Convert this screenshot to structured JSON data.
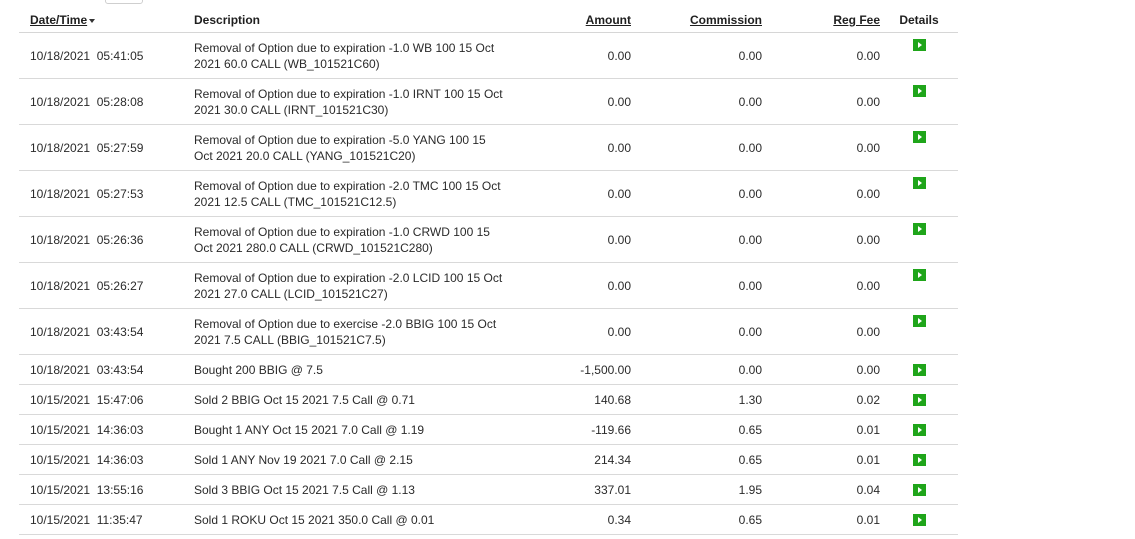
{
  "headers": {
    "datetime": "Date/Time",
    "description": "Description",
    "amount": "Amount",
    "commission": "Commission",
    "reg_fee": "Reg Fee",
    "details": "Details"
  },
  "colors": {
    "negative": "#d0021b",
    "positive": "#1b9a2a",
    "details_button": "#1fa51a"
  },
  "icons": {
    "details": "play-icon",
    "sort": "sort-desc-icon"
  },
  "rows": [
    {
      "datetime": "10/18/2021  05:41:05",
      "desc1": "Removal of Option due to expiration -1.0 WB 100 15 Oct",
      "desc2": "2021 60.0 CALL (WB_101521C60)",
      "amount": "0.00",
      "commission": "0.00",
      "reg_fee": "0.00",
      "sign": ""
    },
    {
      "datetime": "10/18/2021  05:28:08",
      "desc1": "Removal of Option due to expiration -1.0 IRNT 100 15 Oct",
      "desc2": "2021 30.0 CALL (IRNT_101521C30)",
      "amount": "0.00",
      "commission": "0.00",
      "reg_fee": "0.00",
      "sign": ""
    },
    {
      "datetime": "10/18/2021  05:27:59",
      "desc1": "Removal of Option due to expiration -5.0 YANG 100 15",
      "desc2": "Oct 2021 20.0 CALL (YANG_101521C20)",
      "amount": "0.00",
      "commission": "0.00",
      "reg_fee": "0.00",
      "sign": ""
    },
    {
      "datetime": "10/18/2021  05:27:53",
      "desc1": "Removal of Option due to expiration -2.0 TMC 100 15 Oct",
      "desc2": "2021 12.5 CALL (TMC_101521C12.5)",
      "amount": "0.00",
      "commission": "0.00",
      "reg_fee": "0.00",
      "sign": ""
    },
    {
      "datetime": "10/18/2021  05:26:36",
      "desc1": "Removal of Option due to expiration -1.0 CRWD 100 15",
      "desc2": "Oct 2021 280.0 CALL (CRWD_101521C280)",
      "amount": "0.00",
      "commission": "0.00",
      "reg_fee": "0.00",
      "sign": ""
    },
    {
      "datetime": "10/18/2021  05:26:27",
      "desc1": "Removal of Option due to expiration -2.0 LCID 100 15 Oct",
      "desc2": "2021 27.0 CALL (LCID_101521C27)",
      "amount": "0.00",
      "commission": "0.00",
      "reg_fee": "0.00",
      "sign": ""
    },
    {
      "datetime": "10/18/2021  03:43:54",
      "desc1": "Removal of Option due to exercise -2.0 BBIG 100 15 Oct",
      "desc2": "2021 7.5 CALL (BBIG_101521C7.5)",
      "amount": "0.00",
      "commission": "0.00",
      "reg_fee": "0.00",
      "sign": ""
    },
    {
      "datetime": "10/18/2021  03:43:54",
      "desc1": "Bought 200 BBIG @ 7.5",
      "desc2": "",
      "amount": "-1,500.00",
      "commission": "0.00",
      "reg_fee": "0.00",
      "sign": "neg"
    },
    {
      "datetime": "10/15/2021  15:47:06",
      "desc1": "Sold 2 BBIG Oct 15 2021 7.5 Call @ 0.71",
      "desc2": "",
      "amount": "140.68",
      "commission": "1.30",
      "reg_fee": "0.02",
      "sign": "pos"
    },
    {
      "datetime": "10/15/2021  14:36:03",
      "desc1": "Bought 1 ANY Oct 15 2021 7.0 Call @ 1.19",
      "desc2": "",
      "amount": "-119.66",
      "commission": "0.65",
      "reg_fee": "0.01",
      "sign": "neg"
    },
    {
      "datetime": "10/15/2021  14:36:03",
      "desc1": "Sold 1 ANY Nov 19 2021 7.0 Call @ 2.15",
      "desc2": "",
      "amount": "214.34",
      "commission": "0.65",
      "reg_fee": "0.01",
      "sign": "pos"
    },
    {
      "datetime": "10/15/2021  13:55:16",
      "desc1": "Sold 3 BBIG Oct 15 2021 7.5 Call @ 1.13",
      "desc2": "",
      "amount": "337.01",
      "commission": "1.95",
      "reg_fee": "0.04",
      "sign": "pos"
    },
    {
      "datetime": "10/15/2021  11:35:47",
      "desc1": "Sold 1 ROKU Oct 15 2021 350.0 Call @ 0.01",
      "desc2": "",
      "amount": "0.34",
      "commission": "0.65",
      "reg_fee": "0.01",
      "sign": "pos"
    }
  ]
}
